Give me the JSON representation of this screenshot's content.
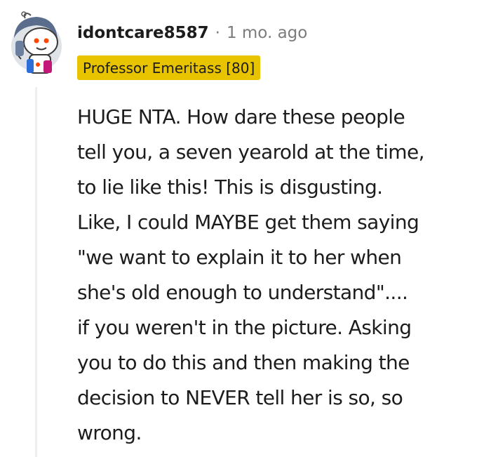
{
  "comment": {
    "username": "idontcare8587",
    "separator": "·",
    "timestamp": "1 mo. ago",
    "flair": "Professor Emeritass [80]",
    "flair_color": "#e8c300",
    "avatar_icon": "snoo-astronaut-avatar-icon",
    "body_lines": [
      "HUGE NTA. How dare these people",
      "tell you, a seven yearold at the time,",
      "to lie like this! This is disgusting.",
      "Like, I could MAYBE get them saying",
      "\"we want to explain it to her when",
      "she's old enough to understand\"....",
      "if you weren't in the picture. Asking",
      "you to do this and then making the",
      "decision to NEVER tell her is so, so",
      "wrong."
    ]
  }
}
